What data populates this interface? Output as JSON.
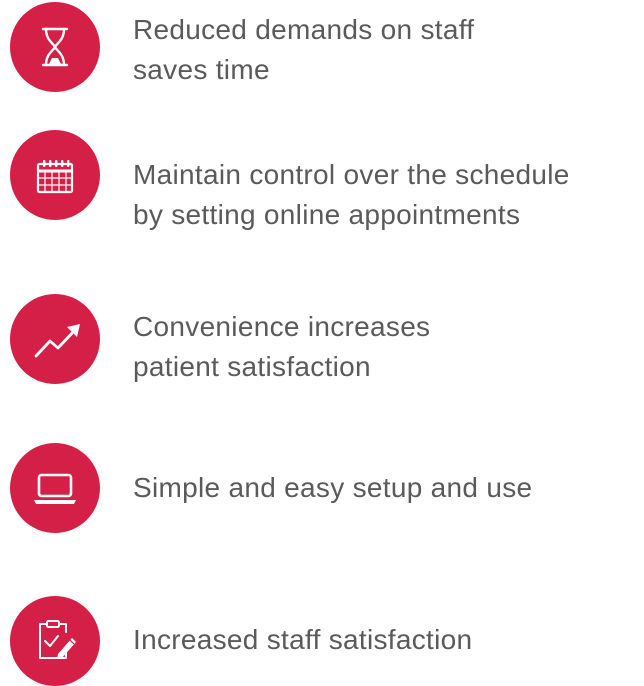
{
  "colors": {
    "accent": "#d41f46",
    "text": "#5a5a5a",
    "icon_stroke": "#ffffff"
  },
  "features": [
    {
      "icon": "hourglass-icon",
      "lines": [
        "Reduced demands on staff",
        "saves time"
      ]
    },
    {
      "icon": "calendar-icon",
      "lines": [
        "Maintain control over the schedule",
        "by setting online appointments"
      ]
    },
    {
      "icon": "trend-up-arrow-icon",
      "lines": [
        "Convenience increases",
        "patient satisfaction"
      ]
    },
    {
      "icon": "laptop-icon",
      "lines": [
        "Simple and easy setup and use"
      ]
    },
    {
      "icon": "clipboard-check-icon",
      "lines": [
        "Increased staff satisfaction"
      ]
    }
  ]
}
